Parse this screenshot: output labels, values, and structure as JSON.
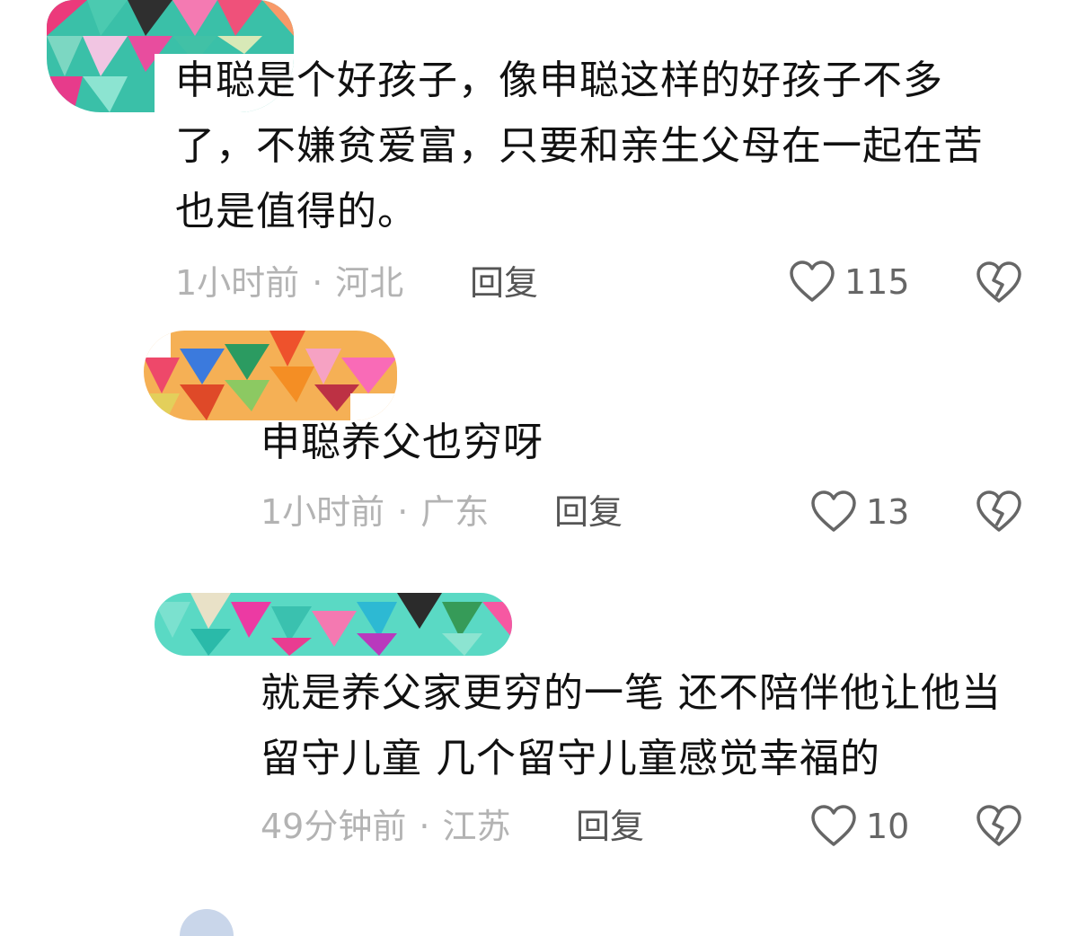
{
  "comments": [
    {
      "text": "申聪是个好孩子，像申聪这样的好孩子不多了，不嫌贫爱富，只要和亲生父母在一起在苦也是值得的。",
      "time": "1小时前",
      "location": "河北",
      "reply_label": "回复",
      "likes": "115"
    },
    {
      "text": "申聪养父也穷呀",
      "time": "1小时前",
      "location": "广东",
      "reply_label": "回复",
      "likes": "13"
    },
    {
      "text": "就是养父家更穷的一笔 还不陪伴他让他当留守儿童 几个留守儿童感觉幸福的",
      "time": "49分钟前",
      "location": "江苏",
      "reply_label": "回复",
      "likes": "10"
    }
  ],
  "separator": "·",
  "icons": {
    "like": "heart-outline-icon",
    "dislike": "broken-heart-icon"
  },
  "colors": {
    "body_text": "#111111",
    "meta_text": "#b3b3b3",
    "reply_text": "#555555",
    "icon_stroke": "#666666"
  }
}
